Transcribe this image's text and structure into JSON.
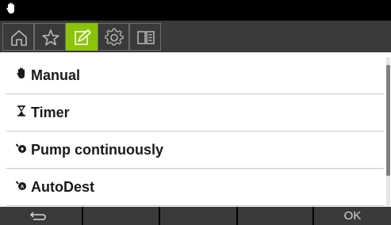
{
  "status_bar": {
    "mode_icon": "hand-icon"
  },
  "tabs": [
    {
      "icon": "home-icon",
      "active": false
    },
    {
      "icon": "star-icon",
      "active": false
    },
    {
      "icon": "edit-icon",
      "active": true
    },
    {
      "icon": "gear-icon",
      "active": false
    },
    {
      "icon": "book-icon",
      "active": false
    }
  ],
  "menu": {
    "items": [
      {
        "icon": "hand-icon",
        "label": "Manual"
      },
      {
        "icon": "hourglass-icon",
        "label": "Timer"
      },
      {
        "icon": "pump-icon",
        "label": "Pump continuously"
      },
      {
        "icon": "pump-auto-icon",
        "label": "AutoDest"
      }
    ]
  },
  "softkeys": {
    "back_icon": "back-arrow-icon",
    "ok_label": "OK"
  },
  "colors": {
    "accent": "#8bc400",
    "toolbar": "#3a3a3a",
    "status_bar": "#000000"
  }
}
